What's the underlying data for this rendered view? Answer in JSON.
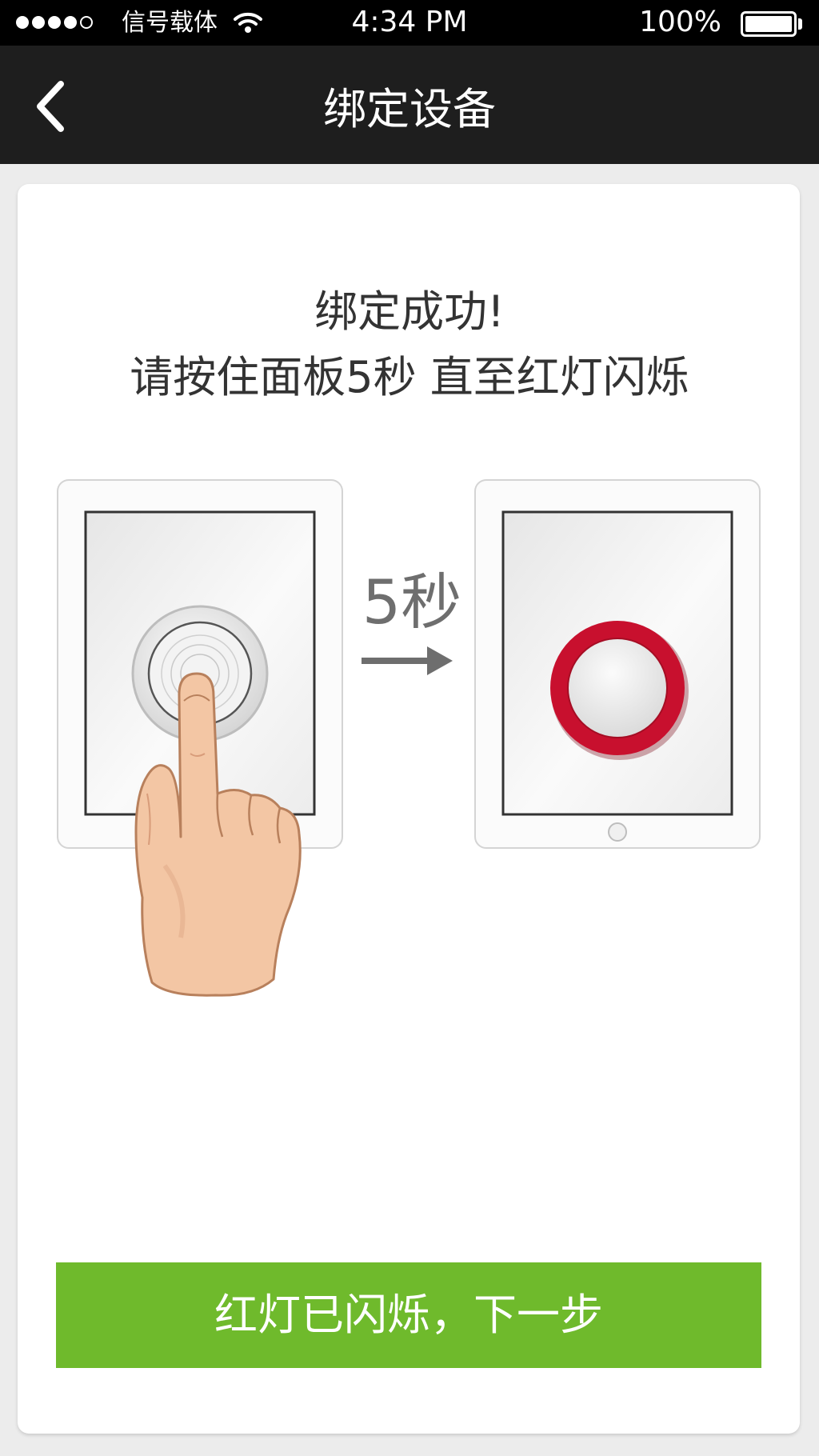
{
  "status_bar": {
    "carrier": "信号载体",
    "time": "4:34 PM",
    "battery": "100%",
    "signal_bars_filled": 4,
    "signal_bars_total": 5
  },
  "nav": {
    "title": "绑定设备",
    "back_icon": "chevron-left-icon"
  },
  "instructions": {
    "line1": "绑定成功!",
    "line2": "请按住面板5秒 直至红灯闪烁"
  },
  "illustration": {
    "duration_label": "5秒",
    "arrow_icon": "arrow-right-icon",
    "hand_icon": "pointing-hand-icon",
    "light_color": "#c8102e"
  },
  "next_button": {
    "label": "红灯已闪烁，下一步",
    "color": "#6fba2c"
  }
}
